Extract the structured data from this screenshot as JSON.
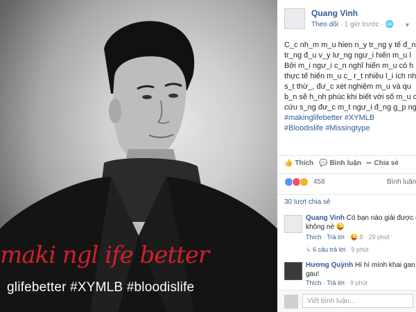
{
  "photo": {
    "signature": "maki ngl ife better",
    "hashtags": "glifebetter #XYMLB #bloodislife"
  },
  "post": {
    "author": "Quang Vinh",
    "follow_label": "Theo dõi",
    "time": "· 1 giờ trước ·",
    "globe": "🌐",
    "body_lines": [
      "C_c nh_m m_u hien n_y tr_ng y tế đ_n",
      "tr_ng đ_u v_y lư_ng ngư_i hiến m_u l",
      "Bởi m_i ngư_i c_n nghĩ hiến m_u có h",
      "thực tế hiến m_u c_ r_t nhiều l_i ích nh",
      "s_t thừ_, đư_c xét nghiệm m_u và qu",
      "b_n sẽ h_nh phúc khi biết với số m_u c",
      "cứu s_ng đư_c m_t ngư_i đ_ng g_p ng"
    ],
    "tags_line1": "#makinglifebetter #XYMLB",
    "tags_line2": "#Bloodislife #Missingtype"
  },
  "actions": {
    "like": "Thích",
    "comment": "Bình luận",
    "share": "Chia sẻ"
  },
  "reactions": {
    "count": "458",
    "top_comments": "Bình luận",
    "shares": "30 lượt chia sẻ"
  },
  "comments": [
    {
      "name": "Quang Vinh",
      "text1": "Có bạn nào giải được ca",
      "text2": "không nè 😜",
      "like": "Thích",
      "reply": "Trả lời",
      "reacts": "😜 8 · 29 phút"
    },
    {
      "name": "Hương Quỳnh",
      "text1": "Hí hí mình khai gan ch",
      "text2": "gau!",
      "like": "Thích",
      "reply": "Trả lời",
      "reacts": "· 9 phút"
    }
  ],
  "reply_link": "6 câu trả lời",
  "reply_time": "· 9 phút",
  "write_placeholder": "Viết bình luận..."
}
